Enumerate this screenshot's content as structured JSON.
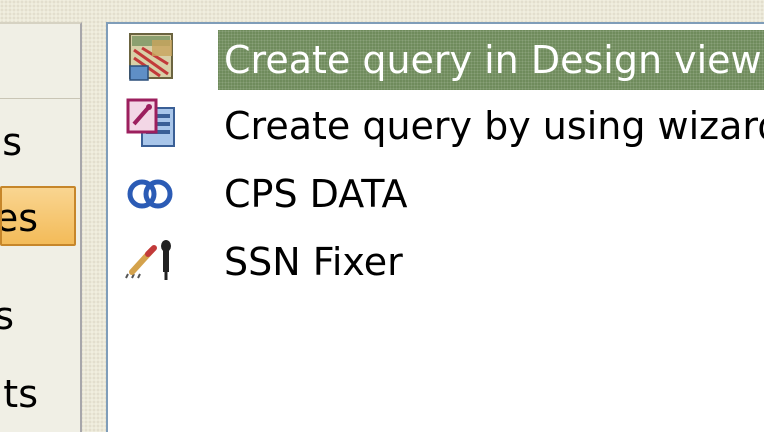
{
  "objects_bar": {
    "items": [
      {
        "label": "s"
      },
      {
        "label": "es"
      },
      {
        "label": "s"
      },
      {
        "label": "ts"
      }
    ]
  },
  "query_list": {
    "items": [
      {
        "label": "Create query in Design view",
        "icon": "design-view-icon",
        "selected": true
      },
      {
        "label": "Create query by using wizard",
        "icon": "wizard-icon",
        "selected": false
      },
      {
        "label": "CPS DATA",
        "icon": "query-join-icon",
        "selected": false
      },
      {
        "label": "SSN Fixer",
        "icon": "update-query-icon",
        "selected": false
      }
    ]
  },
  "colors": {
    "selection_bg": "#6f8b5c",
    "selected_object_bg": "#f7c978",
    "pane_border": "#7f9db9"
  }
}
